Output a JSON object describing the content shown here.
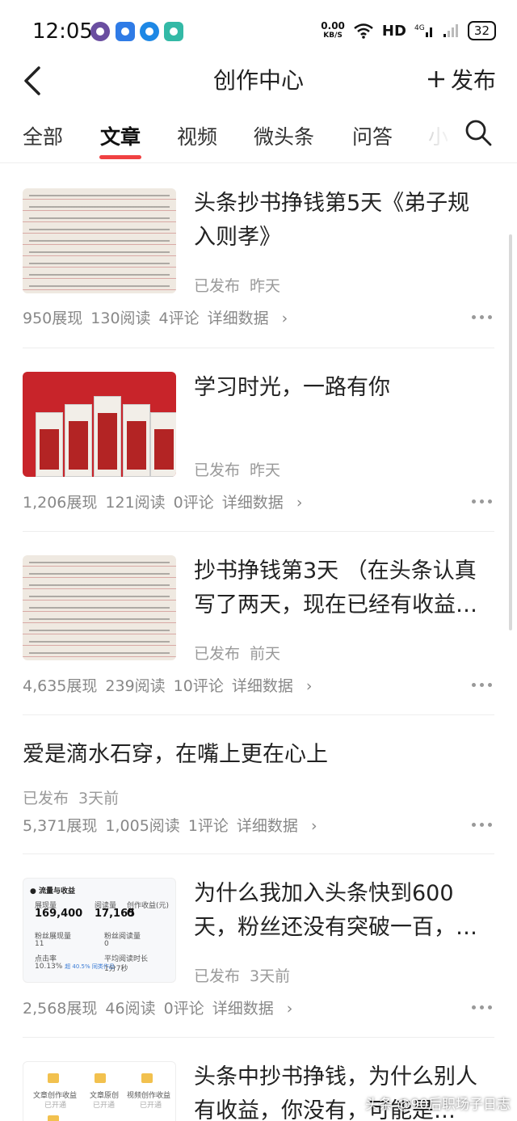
{
  "status_bar": {
    "time": "12:05",
    "net_speed_value": "0.00",
    "net_speed_unit": "KB/S",
    "hd_label": "HD",
    "network_label": "4G",
    "battery": "32"
  },
  "nav": {
    "title": "创作中心",
    "publish_label": "发布"
  },
  "tabs": [
    {
      "label": "全部",
      "active": false
    },
    {
      "label": "文章",
      "active": true
    },
    {
      "label": "视频",
      "active": false
    },
    {
      "label": "微头条",
      "active": false
    },
    {
      "label": "问答",
      "active": false
    },
    {
      "label": "小",
      "active": false
    }
  ],
  "articles": [
    {
      "title": "头条抄书挣钱第5天《弟子规 入则孝》",
      "status": "已发布",
      "time": "昨天",
      "views": "950展现",
      "reads": "130阅读",
      "comments": "4评论",
      "detail": "详细数据",
      "thumb": "handwriting"
    },
    {
      "title": "学习时光，一路有你",
      "status": "已发布",
      "time": "昨天",
      "views": "1,206展现",
      "reads": "121阅读",
      "comments": "0评论",
      "detail": "详细数据",
      "thumb": "pen-boxes"
    },
    {
      "title": "抄书挣钱第3天 （在头条认真写了两天，现在已经有收益…",
      "status": "已发布",
      "time": "前天",
      "views": "4,635展现",
      "reads": "239阅读",
      "comments": "10评论",
      "detail": "详细数据",
      "thumb": "handwriting"
    },
    {
      "title": "爱是滴水石穿，在嘴上更在心上",
      "status": "已发布",
      "time": "3天前",
      "views": "5,371展现",
      "reads": "1,005阅读",
      "comments": "1评论",
      "detail": "详细数据",
      "thumb": "none"
    },
    {
      "title": "为什么我加入头条快到600天，粉丝还没有突破一百，…",
      "status": "已发布",
      "time": "3天前",
      "views": "2,568展现",
      "reads": "46阅读",
      "comments": "0评论",
      "detail": "详细数据",
      "thumb": "stats-screenshot",
      "thumb_text": {
        "header": "流量与收益",
        "show_label": "展现量",
        "show_value": "169,400",
        "read_label": "阅读量",
        "read_value": "17,165",
        "income_label": "创作收益(元)",
        "income_value": "0",
        "fans_show_label": "粉丝展现量",
        "fans_show_value": "11",
        "fans_read_label": "粉丝阅读量",
        "fans_read_value": "0",
        "ctr_label": "点击率",
        "ctr_value": "10.13%",
        "ctr_note": "超 40.5% 同类作品",
        "avg_label": "平均阅读时长",
        "avg_value": "1分7秒"
      }
    },
    {
      "title": "头条中抄书挣钱，为什么别人有收益，你没有，可能是…",
      "thumb": "income-screenshot",
      "thumb_text": {
        "a": "文章创作收益",
        "a_status": "已开通",
        "b": "文章原创",
        "b_status": "已开通",
        "c": "视频创作收益",
        "c_status": "已开通"
      }
    }
  ],
  "watermark": "头条 @90后职场子日志"
}
